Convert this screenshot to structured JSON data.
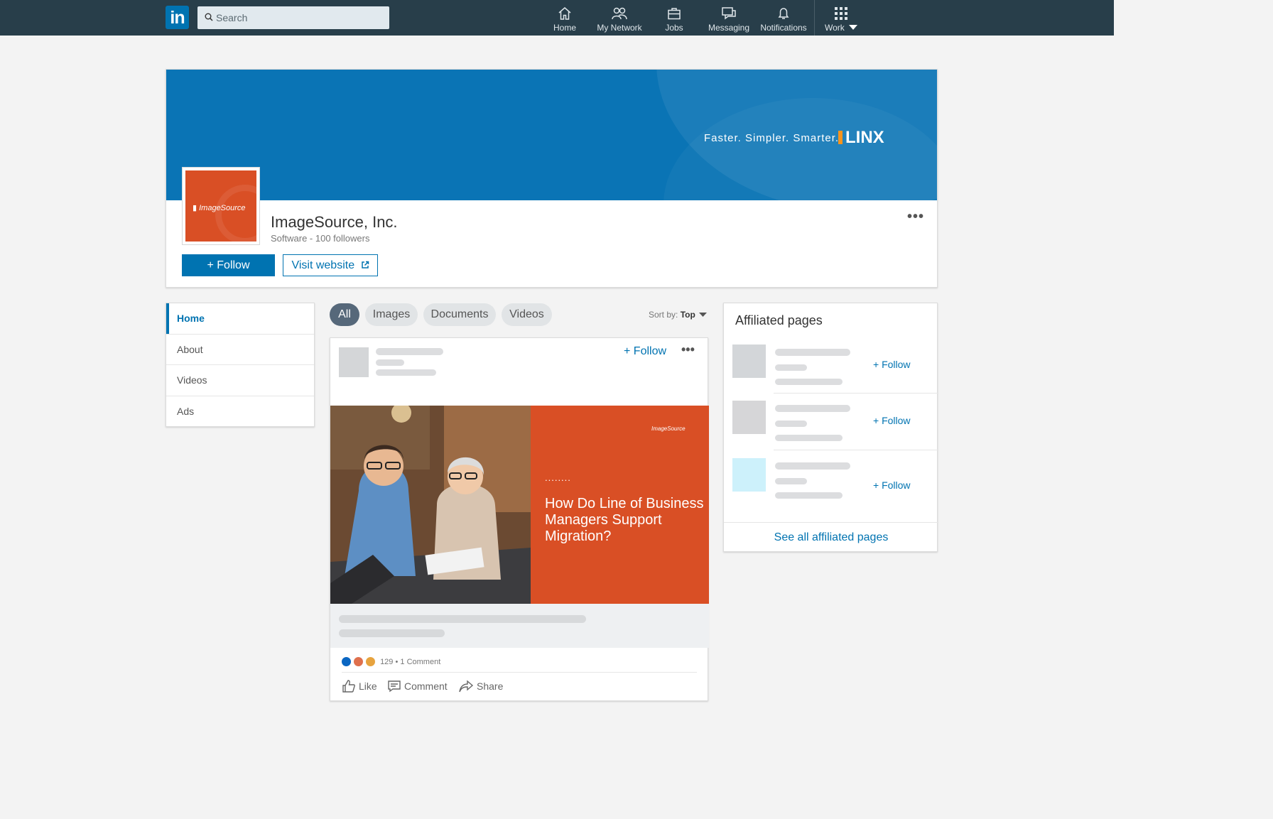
{
  "nav": {
    "logo": "in",
    "search_placeholder": "Search",
    "items": [
      {
        "label": "Home",
        "icon": "home-icon"
      },
      {
        "label": "My Network",
        "icon": "network-icon"
      },
      {
        "label": "Jobs",
        "icon": "jobs-icon"
      },
      {
        "label": "Messaging",
        "icon": "messaging-icon"
      },
      {
        "label": "Notifications",
        "icon": "bell-icon"
      },
      {
        "label": "Work",
        "icon": "grid-icon"
      }
    ]
  },
  "banner": {
    "tagline": "Faster. Simpler. Smarter.",
    "brand": "LINX"
  },
  "company": {
    "logo_text": "ImageSource",
    "name": "ImageSource, Inc.",
    "meta": "Software - 100 followers",
    "follow_label": "+ Follow",
    "visit_label": "Visit website",
    "more": "..."
  },
  "sidebar": {
    "items": [
      {
        "label": "Home",
        "active": true
      },
      {
        "label": "About"
      },
      {
        "label": "Videos"
      },
      {
        "label": "Ads"
      }
    ]
  },
  "filters": {
    "tabs": [
      "All",
      "Images",
      "Documents",
      "Videos"
    ],
    "sort_label": "Sort by:",
    "sort_value": "Top"
  },
  "post": {
    "follow_label": "+ Follow",
    "more": "...",
    "image_brand": "ImageSource",
    "image_dots": "........",
    "headline": "How Do Line of Business Managers Support Migration?",
    "reaction_count": "129",
    "comment_count": "1 Comment",
    "actions": {
      "like": "Like",
      "comment": "Comment",
      "share": "Share"
    }
  },
  "affiliated": {
    "title": "Affiliated pages",
    "follow_label": "+ Follow",
    "see_all": "See all affiliated pages"
  },
  "colors": {
    "nav_bg": "#283e4a",
    "brand_blue": "#0073b1",
    "cover_blue": "#0a74b5",
    "orange": "#d94f25",
    "linx_accent": "#f7941d"
  }
}
